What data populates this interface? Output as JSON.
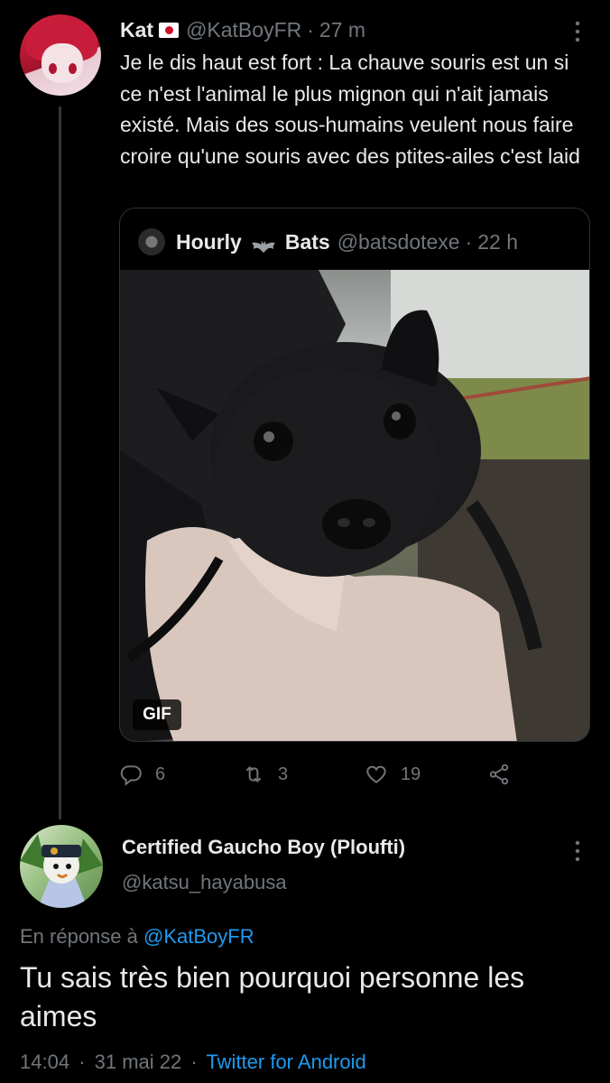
{
  "tweet": {
    "author_name": "Kat",
    "handle": "@KatBoyFR",
    "time": "27 m",
    "text": "Je le dis haut est fort : La chauve souris est un si ce n'est l'animal le plus mignon qui n'ait jamais existé. Mais des sous-humains veulent nous faire croire qu'une souris avec des ptites-ailes c'est laid",
    "quote": {
      "name_part1": "Hourly",
      "name_part2": "Bats",
      "handle": "@batsdotexe",
      "time": "22 h",
      "media_badge": "GIF"
    },
    "actions": {
      "replies": "6",
      "retweets": "3",
      "likes": "19"
    }
  },
  "reply": {
    "author_name": "Certified Gaucho Boy (Ploufti)",
    "handle": "@katsu_hayabusa",
    "reply_to_label": "En réponse à",
    "reply_to_handle": "@KatBoyFR",
    "text": "Tu sais très bien pourquoi personne les aimes",
    "time": "14:04",
    "date": "31 mai 22",
    "source": "Twitter for Android"
  },
  "separator": "·",
  "colors": {
    "background": "#000000",
    "text": "#e7e9ea",
    "muted": "#71767b",
    "link": "#1d9bf0",
    "border": "#2f3336"
  },
  "icons": [
    "reply-icon",
    "retweet-icon",
    "like-icon",
    "share-icon",
    "more-icon",
    "bat-icon",
    "flag-icon"
  ]
}
